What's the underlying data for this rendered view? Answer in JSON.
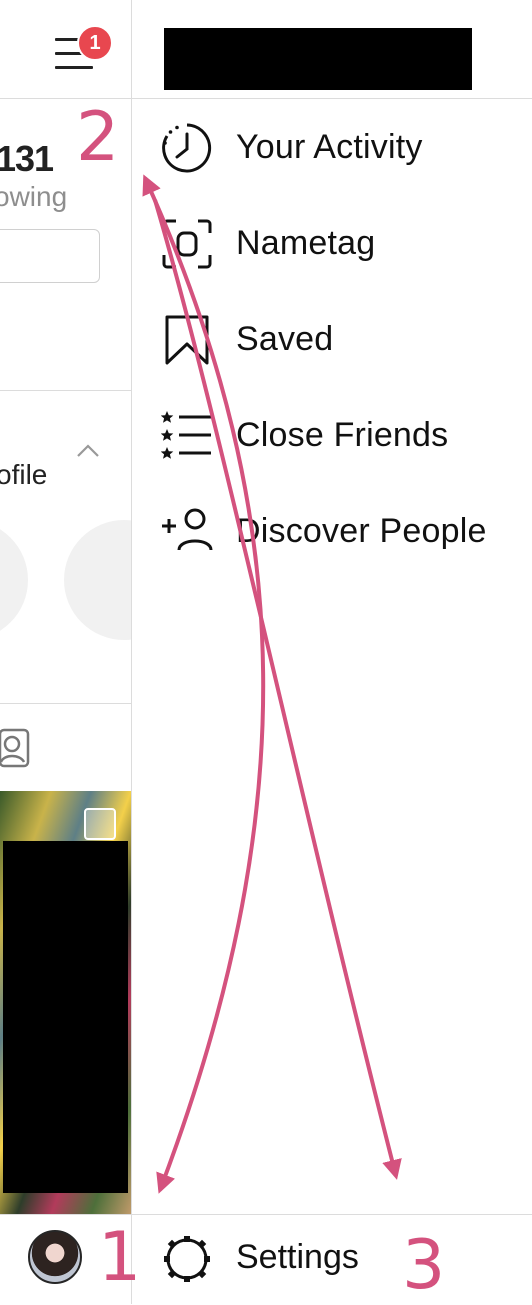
{
  "underlying_profile": {
    "notification_count": "1",
    "following_count": "131",
    "following_label": "owing",
    "discover_label": "ofile"
  },
  "side_menu": {
    "items": [
      {
        "label": "Your Activity",
        "icon": "activity-clock-icon"
      },
      {
        "label": "Nametag",
        "icon": "nametag-icon"
      },
      {
        "label": "Saved",
        "icon": "bookmark-icon"
      },
      {
        "label": "Close Friends",
        "icon": "close-friends-icon"
      },
      {
        "label": "Discover People",
        "icon": "add-person-icon"
      }
    ],
    "settings": {
      "label": "Settings",
      "icon": "gear-icon"
    }
  },
  "annotations": {
    "step_1": "1",
    "step_2": "2",
    "step_3": "3",
    "color": "#d4527e"
  },
  "colors": {
    "badge": "#e8474f",
    "divider": "#dcdcdc",
    "muted_text": "#8e8e8e"
  }
}
